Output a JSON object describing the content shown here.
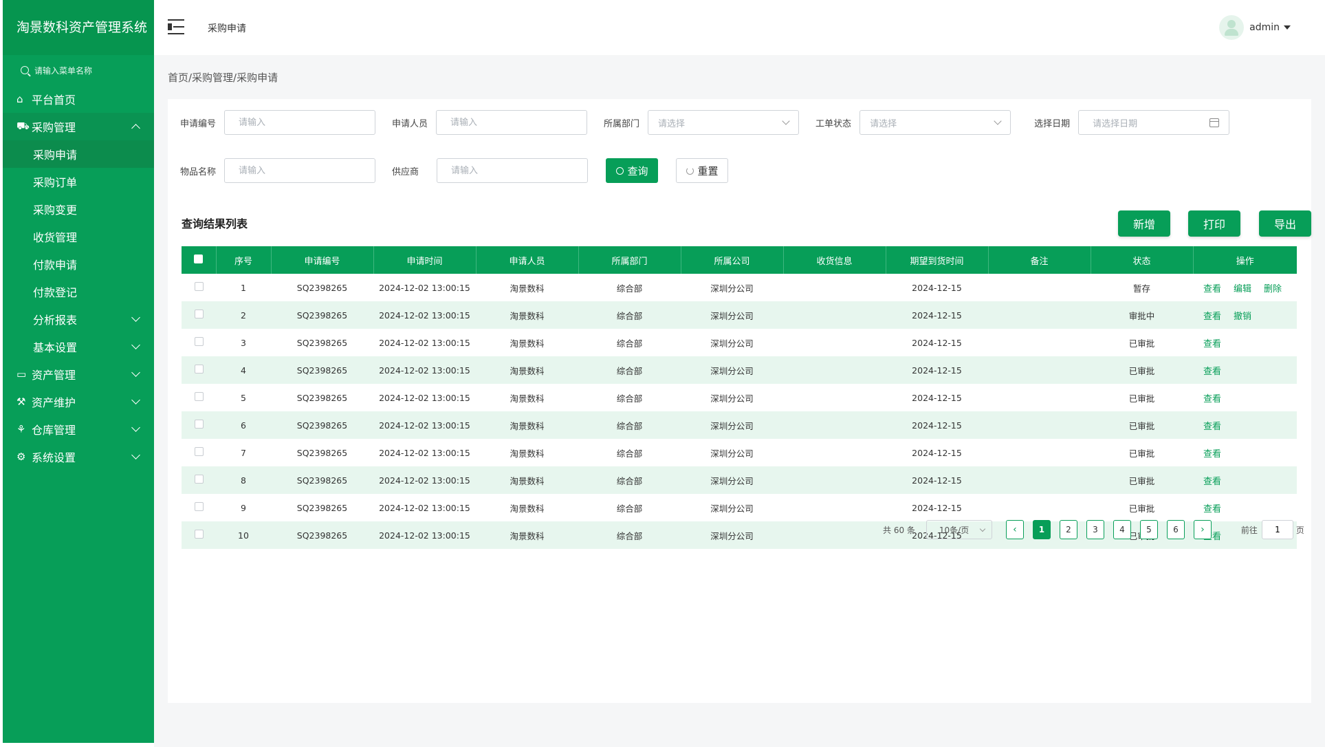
{
  "app": {
    "title": "淘景数科资产管理系统",
    "menu_search_placeholder": "请输入菜单名称"
  },
  "colors": {
    "brand": "#079e58",
    "row_alt": "#e7f6ee"
  },
  "sidebar": {
    "items": [
      {
        "label": "平台首页",
        "icon": "home-icon"
      },
      {
        "label": "采购管理",
        "icon": "cart-icon",
        "expanded": true
      },
      {
        "label": "资产管理",
        "icon": "monitor-icon"
      },
      {
        "label": "资产维护",
        "icon": "wrench-icon"
      },
      {
        "label": "仓库管理",
        "icon": "warehouse-icon"
      },
      {
        "label": "系统设置",
        "icon": "gear-icon"
      }
    ],
    "sub_items": [
      "采购申请",
      "采购订单",
      "采购变更",
      "收货管理",
      "付款申请",
      "付款登记",
      "分析报表",
      "基本设置"
    ]
  },
  "header": {
    "title": "采购申请",
    "user": "admin"
  },
  "breadcrumb": "首页/采购管理/采购申请",
  "filters": {
    "apply_no": {
      "label": "申请编号",
      "placeholder": "请输入"
    },
    "applicant": {
      "label": "申请人员",
      "placeholder": "请输入"
    },
    "department": {
      "label": "所属部门",
      "placeholder": "请选择"
    },
    "order_status": {
      "label": "工单状态",
      "placeholder": "请选择"
    },
    "date": {
      "label": "选择日期",
      "placeholder": "请选择日期"
    },
    "item_name": {
      "label": "物品名称",
      "placeholder": "请输入"
    },
    "supplier": {
      "label": "供应商",
      "placeholder": "请输入"
    },
    "query_label": "查询",
    "reset_label": "重置"
  },
  "list": {
    "title": "查询结果列表",
    "actions": {
      "add": "新增",
      "print": "打印",
      "export": "导出"
    },
    "columns": [
      "序号",
      "申请编号",
      "申请时间",
      "申请人员",
      "所属部门",
      "所属公司",
      "收货信息",
      "期望到货时间",
      "备注",
      "状态",
      "操作"
    ],
    "rows": [
      {
        "no": "1",
        "code": "SQ2398265",
        "time": "2024-12-02 13:00:15",
        "applicant": "淘景数科",
        "dept": "综合部",
        "company": "深圳分公司",
        "receipt": "",
        "expect": "2024-12-15",
        "remark": "",
        "status": "暂存",
        "ops": [
          "查看",
          "编辑",
          "删除"
        ]
      },
      {
        "no": "2",
        "code": "SQ2398265",
        "time": "2024-12-02 13:00:15",
        "applicant": "淘景数科",
        "dept": "综合部",
        "company": "深圳分公司",
        "receipt": "",
        "expect": "2024-12-15",
        "remark": "",
        "status": "审批中",
        "ops": [
          "查看",
          "撤销"
        ]
      },
      {
        "no": "3",
        "code": "SQ2398265",
        "time": "2024-12-02 13:00:15",
        "applicant": "淘景数科",
        "dept": "综合部",
        "company": "深圳分公司",
        "receipt": "",
        "expect": "2024-12-15",
        "remark": "",
        "status": "已审批",
        "ops": [
          "查看"
        ]
      },
      {
        "no": "4",
        "code": "SQ2398265",
        "time": "2024-12-02 13:00:15",
        "applicant": "淘景数科",
        "dept": "综合部",
        "company": "深圳分公司",
        "receipt": "",
        "expect": "2024-12-15",
        "remark": "",
        "status": "已审批",
        "ops": [
          "查看"
        ]
      },
      {
        "no": "5",
        "code": "SQ2398265",
        "time": "2024-12-02 13:00:15",
        "applicant": "淘景数科",
        "dept": "综合部",
        "company": "深圳分公司",
        "receipt": "",
        "expect": "2024-12-15",
        "remark": "",
        "status": "已审批",
        "ops": [
          "查看"
        ]
      },
      {
        "no": "6",
        "code": "SQ2398265",
        "time": "2024-12-02 13:00:15",
        "applicant": "淘景数科",
        "dept": "综合部",
        "company": "深圳分公司",
        "receipt": "",
        "expect": "2024-12-15",
        "remark": "",
        "status": "已审批",
        "ops": [
          "查看"
        ]
      },
      {
        "no": "7",
        "code": "SQ2398265",
        "time": "2024-12-02 13:00:15",
        "applicant": "淘景数科",
        "dept": "综合部",
        "company": "深圳分公司",
        "receipt": "",
        "expect": "2024-12-15",
        "remark": "",
        "status": "已审批",
        "ops": [
          "查看"
        ]
      },
      {
        "no": "8",
        "code": "SQ2398265",
        "time": "2024-12-02 13:00:15",
        "applicant": "淘景数科",
        "dept": "综合部",
        "company": "深圳分公司",
        "receipt": "",
        "expect": "2024-12-15",
        "remark": "",
        "status": "已审批",
        "ops": [
          "查看"
        ]
      },
      {
        "no": "9",
        "code": "SQ2398265",
        "time": "2024-12-02 13:00:15",
        "applicant": "淘景数科",
        "dept": "综合部",
        "company": "深圳分公司",
        "receipt": "",
        "expect": "2024-12-15",
        "remark": "",
        "status": "已审批",
        "ops": [
          "查看"
        ]
      },
      {
        "no": "10",
        "code": "SQ2398265",
        "time": "2024-12-02 13:00:15",
        "applicant": "淘景数科",
        "dept": "综合部",
        "company": "深圳分公司",
        "receipt": "",
        "expect": "2024-12-15",
        "remark": "",
        "status": "已审批",
        "ops": [
          "查看"
        ]
      }
    ]
  },
  "pagination": {
    "total": "共 60 条",
    "page_size": "10条/页",
    "pages": [
      "1",
      "2",
      "3",
      "4",
      "5",
      "6"
    ],
    "current": "1",
    "prev": "‹",
    "next": "›",
    "goto_label": "前往",
    "goto_value": "1",
    "page_unit": "页"
  }
}
